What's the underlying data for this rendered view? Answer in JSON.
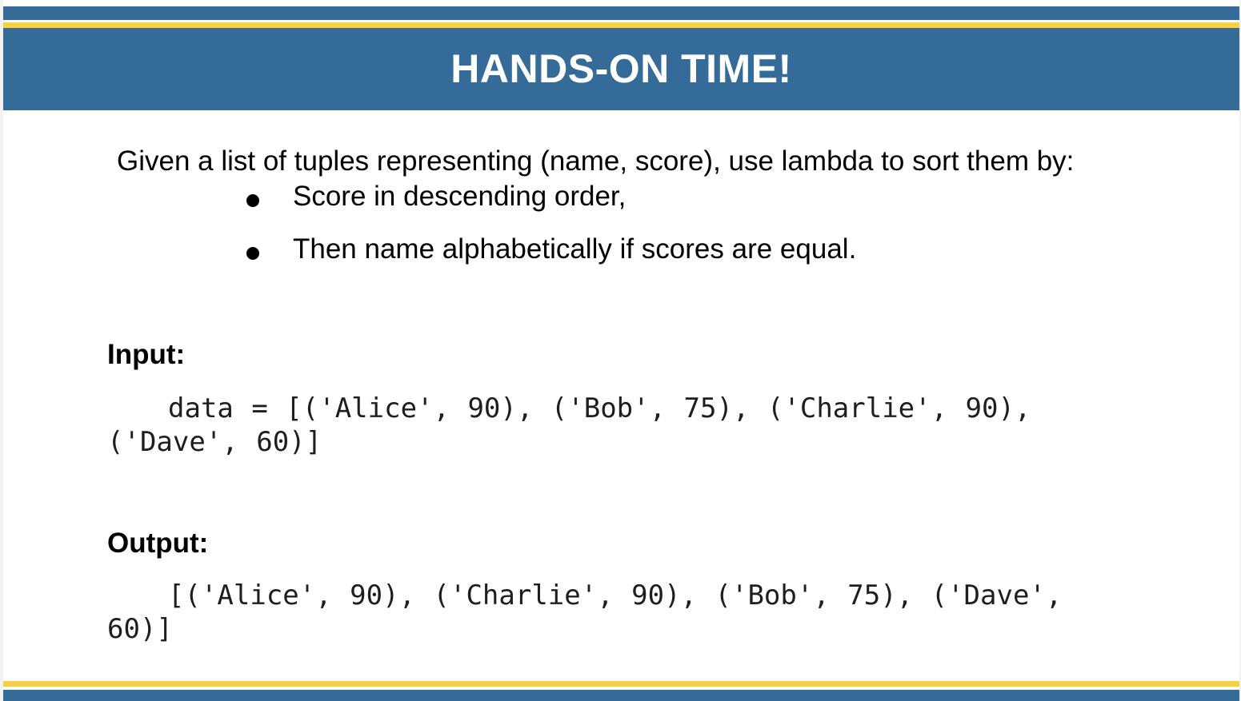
{
  "slide": {
    "title": "HANDS-ON TIME!",
    "prompt": "Given a list of tuples representing (name, score), use lambda to sort them by:",
    "bullets": [
      "Score in descending order,",
      "Then name alphabetically if scores are equal."
    ],
    "input_label": "Input:",
    "input_code": "data = [('Alice', 90), ('Bob', 75), ('Charlie', 90), ('Dave', 60)]",
    "output_label": "Output:",
    "output_code": "[('Alice', 90), ('Charlie', 90), ('Bob', 75), ('Dave', 60)]"
  },
  "colors": {
    "band_blue": "#346b99",
    "stripe_yellow": "#f7d23e",
    "text": "#000000"
  }
}
